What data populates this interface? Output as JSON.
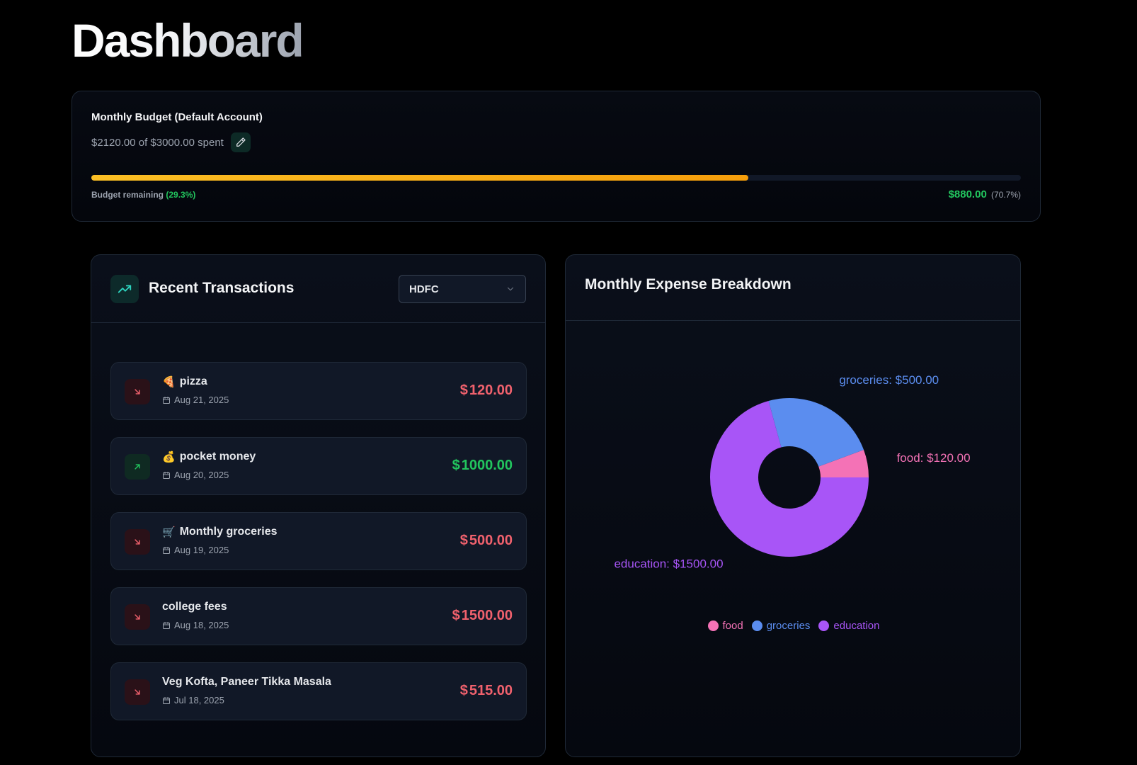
{
  "page": {
    "title": "Dashboard"
  },
  "budget": {
    "title": "Monthly Budget (Default Account)",
    "spent_text": "$2120.00 of $3000.00 spent",
    "spent_fraction": 0.707,
    "remaining_label": "Budget remaining",
    "remaining_pct": "(29.3%)",
    "remaining_amount": "$880.00",
    "spent_pct": "(70.7%)"
  },
  "transactions": {
    "title": "Recent Transactions",
    "account_select": {
      "selected": "HDFC"
    },
    "items": [
      {
        "emoji": "🍕",
        "name": "pizza",
        "date": "Aug 21, 2025",
        "currency": "$",
        "amount": "120.00",
        "direction": "out"
      },
      {
        "emoji": "💰",
        "name": "pocket money",
        "date": "Aug 20, 2025",
        "currency": "$",
        "amount": "1000.00",
        "direction": "in"
      },
      {
        "emoji": "🛒",
        "name": "Monthly groceries",
        "date": "Aug 19, 2025",
        "currency": "$",
        "amount": "500.00",
        "direction": "out"
      },
      {
        "emoji": "",
        "name": "college fees",
        "date": "Aug 18, 2025",
        "currency": "$",
        "amount": "1500.00",
        "direction": "out"
      },
      {
        "emoji": "",
        "name": "Veg Kofta, Paneer Tikka Masala",
        "date": "Jul 18, 2025",
        "currency": "$",
        "amount": "515.00",
        "direction": "out"
      }
    ]
  },
  "breakdown": {
    "title": "Monthly Expense Breakdown"
  },
  "colors": {
    "food": "#f472b6",
    "groceries": "#5b8def",
    "education": "#a855f7",
    "expense": "#f0616d",
    "income": "#22c55e",
    "accent": "#2dd4bf"
  },
  "chart_data": {
    "type": "pie",
    "title": "Monthly Expense Breakdown",
    "categories": [
      "food",
      "groceries",
      "education"
    ],
    "values": [
      120,
      500,
      1500
    ],
    "labels": [
      "food: $120.00",
      "groceries: $500.00",
      "education: $1500.00"
    ],
    "colors": [
      "#f472b6",
      "#5b8def",
      "#a855f7"
    ],
    "legend": "bottom",
    "donut": true
  }
}
